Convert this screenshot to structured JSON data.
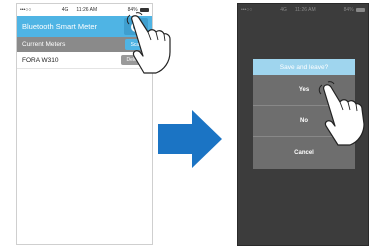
{
  "left_screen": {
    "status": {
      "carrier": "•••○○",
      "network": "4G",
      "time": "11:26 AM",
      "battery": "84%"
    },
    "header_title": "Bluetooth Smart Meter",
    "section_title": "Current Meters",
    "scan_label": "Scan",
    "meters": [
      {
        "name": "FORA W310",
        "delete_label": "Delete"
      }
    ]
  },
  "right_screen": {
    "status": {
      "carrier": "•••○○",
      "network": "4G",
      "time": "11:26 AM",
      "battery": "84%"
    },
    "dialog_title": "Save and leave?",
    "options": [
      "Yes",
      "No",
      "Cancel"
    ]
  },
  "colors": {
    "accent": "#4fb4e4",
    "arrow": "#1b74c4",
    "dialog_title": "#9fd5ee"
  }
}
